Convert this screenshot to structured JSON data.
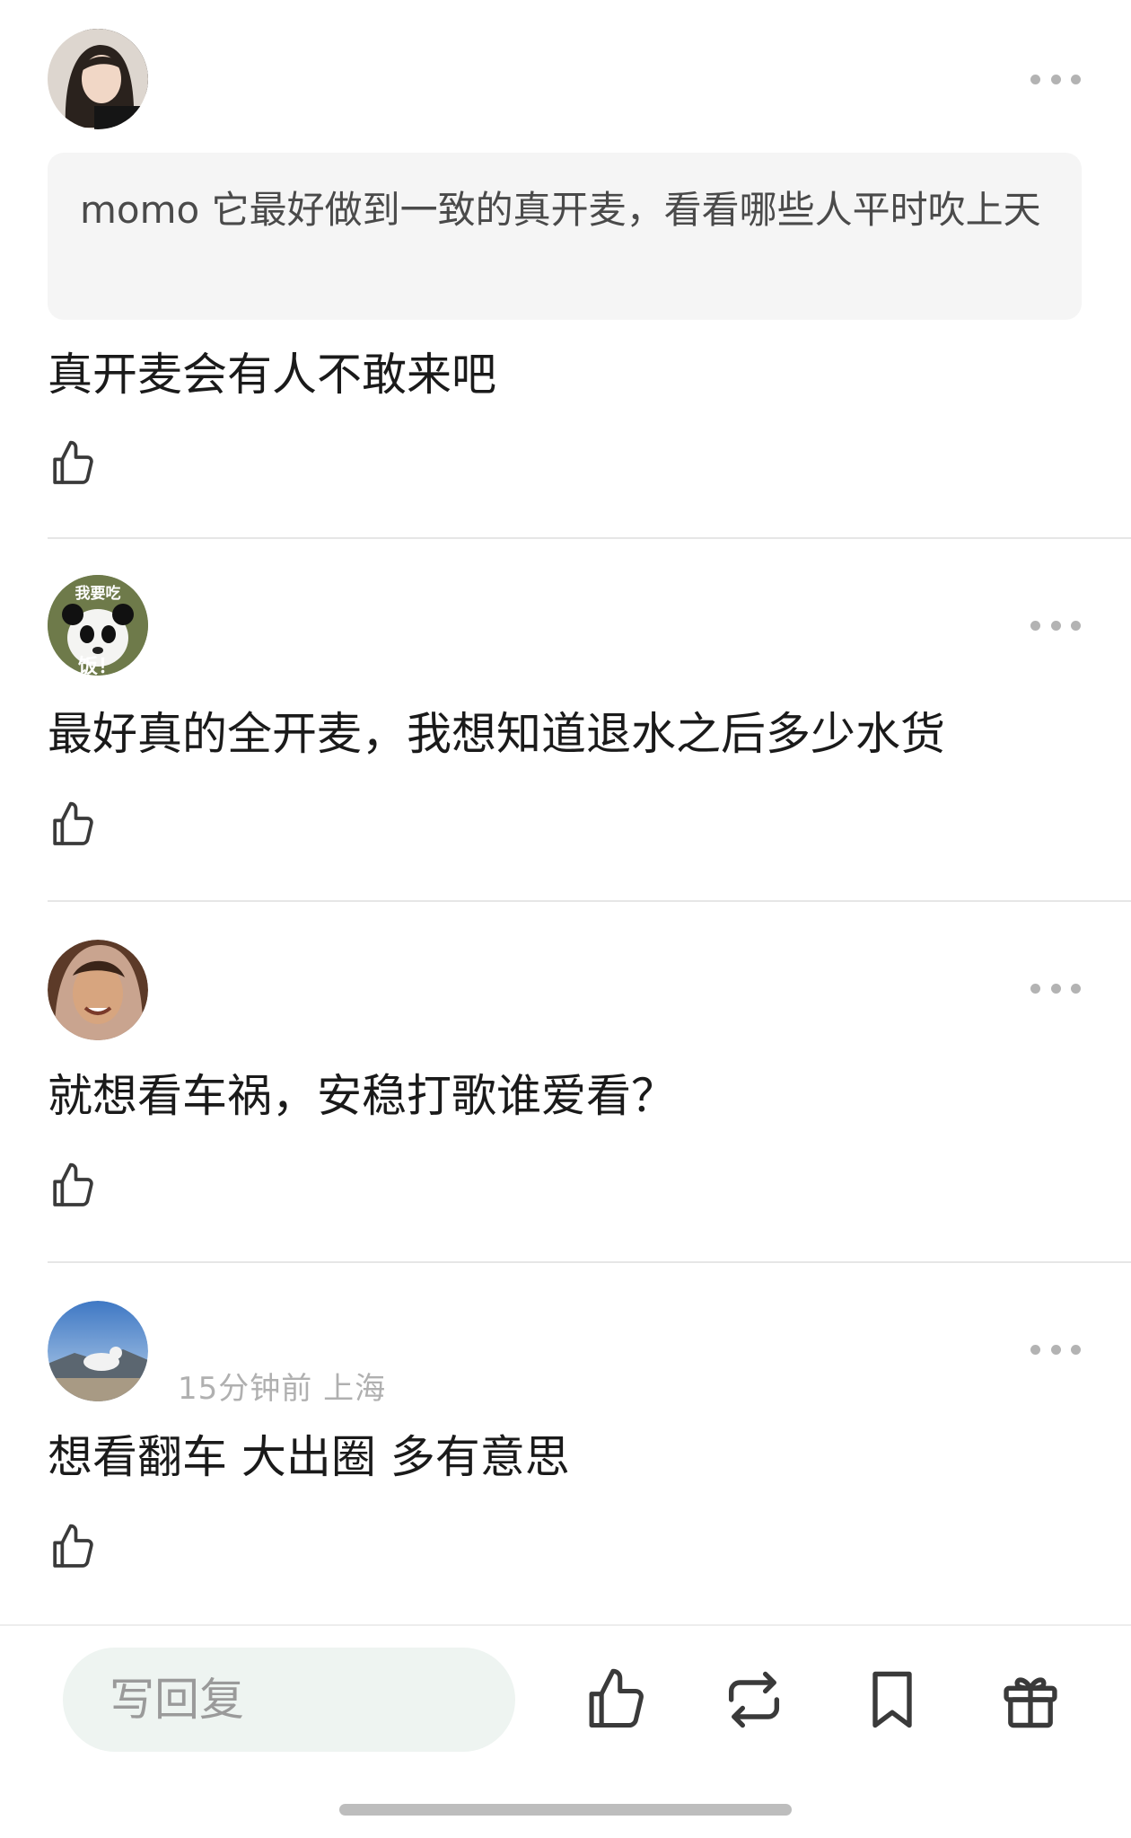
{
  "comments": [
    {
      "quote": "momo 它最好做到一致的真开麦，看看哪些人平时吹上天",
      "text": "真开麦会有人不敢来吧",
      "meta": ""
    },
    {
      "avatar_text_top": "我要吃",
      "avatar_text_bottom": "饭！",
      "text": "最好真的全开麦，我想知道退水之后多少水货",
      "meta": ""
    },
    {
      "text": "就想看车祸，安稳打歌谁爱看？",
      "meta": ""
    },
    {
      "text": "想看翻车 大出圈 多有意思",
      "meta": "15分钟前 上海"
    }
  ],
  "bottombar": {
    "reply_placeholder": "写回复",
    "icons": [
      "thumbs-up-icon",
      "repost-icon",
      "bookmark-icon",
      "gift-icon"
    ]
  },
  "colors": {
    "icon": "#3a3a3a",
    "divider": "#e6e6e6",
    "quote_bg": "#f5f5f5",
    "reply_bg": "#eef4f1"
  }
}
